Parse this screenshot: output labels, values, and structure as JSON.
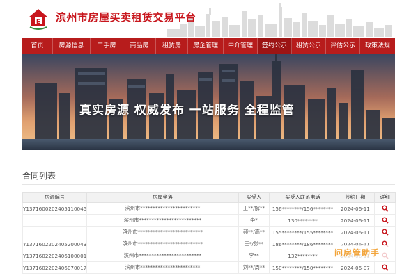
{
  "header": {
    "site_title": "滨州市房屋买卖租赁交易平台"
  },
  "nav": {
    "active_index": 7,
    "items": [
      {
        "label": "首页",
        "w": 44
      },
      {
        "label": "房源信息",
        "w": 54
      },
      {
        "label": "二手房",
        "w": 47
      },
      {
        "label": "商品房",
        "w": 47
      },
      {
        "label": "租赁房",
        "w": 46
      },
      {
        "label": "房企管理",
        "w": 51
      },
      {
        "label": "中介管理",
        "w": 49
      },
      {
        "label": "签约公示",
        "w": 49
      },
      {
        "label": "租赁公示",
        "w": 49
      },
      {
        "label": "评估公示",
        "w": 49
      },
      {
        "label": "政策法规",
        "w": 50
      }
    ]
  },
  "banner": {
    "slogan": "真实房源  权威发布  一站服务  全程监管"
  },
  "contracts": {
    "title": "合同列表",
    "columns": {
      "no": "房源编号",
      "address": "房屋坐落",
      "buyer": "买受人",
      "phone": "买受人联系电话",
      "date": "签约日期",
      "detail": "详细"
    },
    "rows": [
      {
        "no": "Y137160020240511004​5",
        "address": "滨州市************************",
        "buyer": "王**/解**",
        "phone": "156********/156********",
        "date": "2024-06-11"
      },
      {
        "no": "",
        "address": "滨州市*************************",
        "buyer": "李*",
        "phone": "130********",
        "date": "2024-06-11"
      },
      {
        "no": "",
        "address": "滨州市**************************",
        "buyer": "郝**/高**",
        "phone": "155********/155********",
        "date": "2024-06-11"
      },
      {
        "no": "Y137160220240520004​3",
        "address": "滨州市**************************",
        "buyer": "王*/张**",
        "phone": "186********/186********",
        "date": "2024-06-11"
      },
      {
        "no": "Y137160220240610000​1X",
        "address": "滨州市*************************",
        "buyer": "李**",
        "phone": "132********",
        "date": "2024-06-11"
      },
      {
        "no": "Y137160220240607001​7",
        "address": "滨州市************************",
        "buyer": "刘**/周**",
        "phone": "150********/150********",
        "date": "2024-06-07"
      }
    ]
  },
  "watermark": {
    "text": "问房管助手"
  },
  "colors": {
    "brand_red": "#b71c1c",
    "title_red": "#c8161d",
    "watermark_orange": "#f2a43a"
  },
  "icons": {
    "logo": "house-logo-icon",
    "detail": "magnifier-icon"
  }
}
